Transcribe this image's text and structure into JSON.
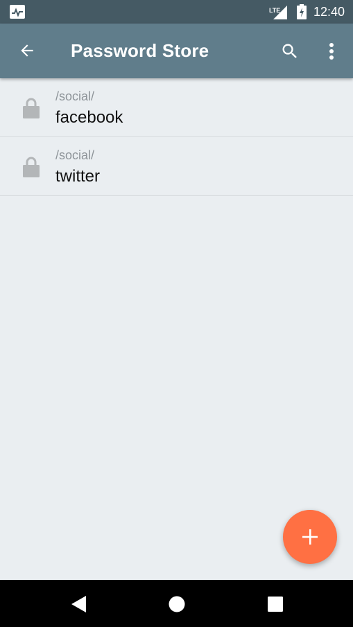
{
  "status_bar": {
    "network_label": "LTE",
    "time": "12:40",
    "left_icon": "activity-monitor-icon",
    "signal_icon": "signal-icon",
    "battery_icon": "battery-charging-icon"
  },
  "app_bar": {
    "title": "Password Store",
    "back_icon": "arrow-back-icon",
    "search_icon": "search-icon",
    "overflow_icon": "more-vert-icon",
    "color": "#607d8b"
  },
  "list": {
    "items": [
      {
        "path": "/social/",
        "name": "facebook",
        "icon": "lock-icon"
      },
      {
        "path": "/social/",
        "name": "twitter",
        "icon": "lock-icon"
      }
    ]
  },
  "fab": {
    "icon": "plus-icon",
    "color": "#ff7043"
  },
  "nav_bar": {
    "back_icon": "nav-back-triangle-icon",
    "home_icon": "nav-home-circle-icon",
    "recents_icon": "nav-recents-square-icon"
  },
  "colors": {
    "status_bar": "#455a64",
    "background": "#eaeef1",
    "accent": "#ff7043"
  }
}
